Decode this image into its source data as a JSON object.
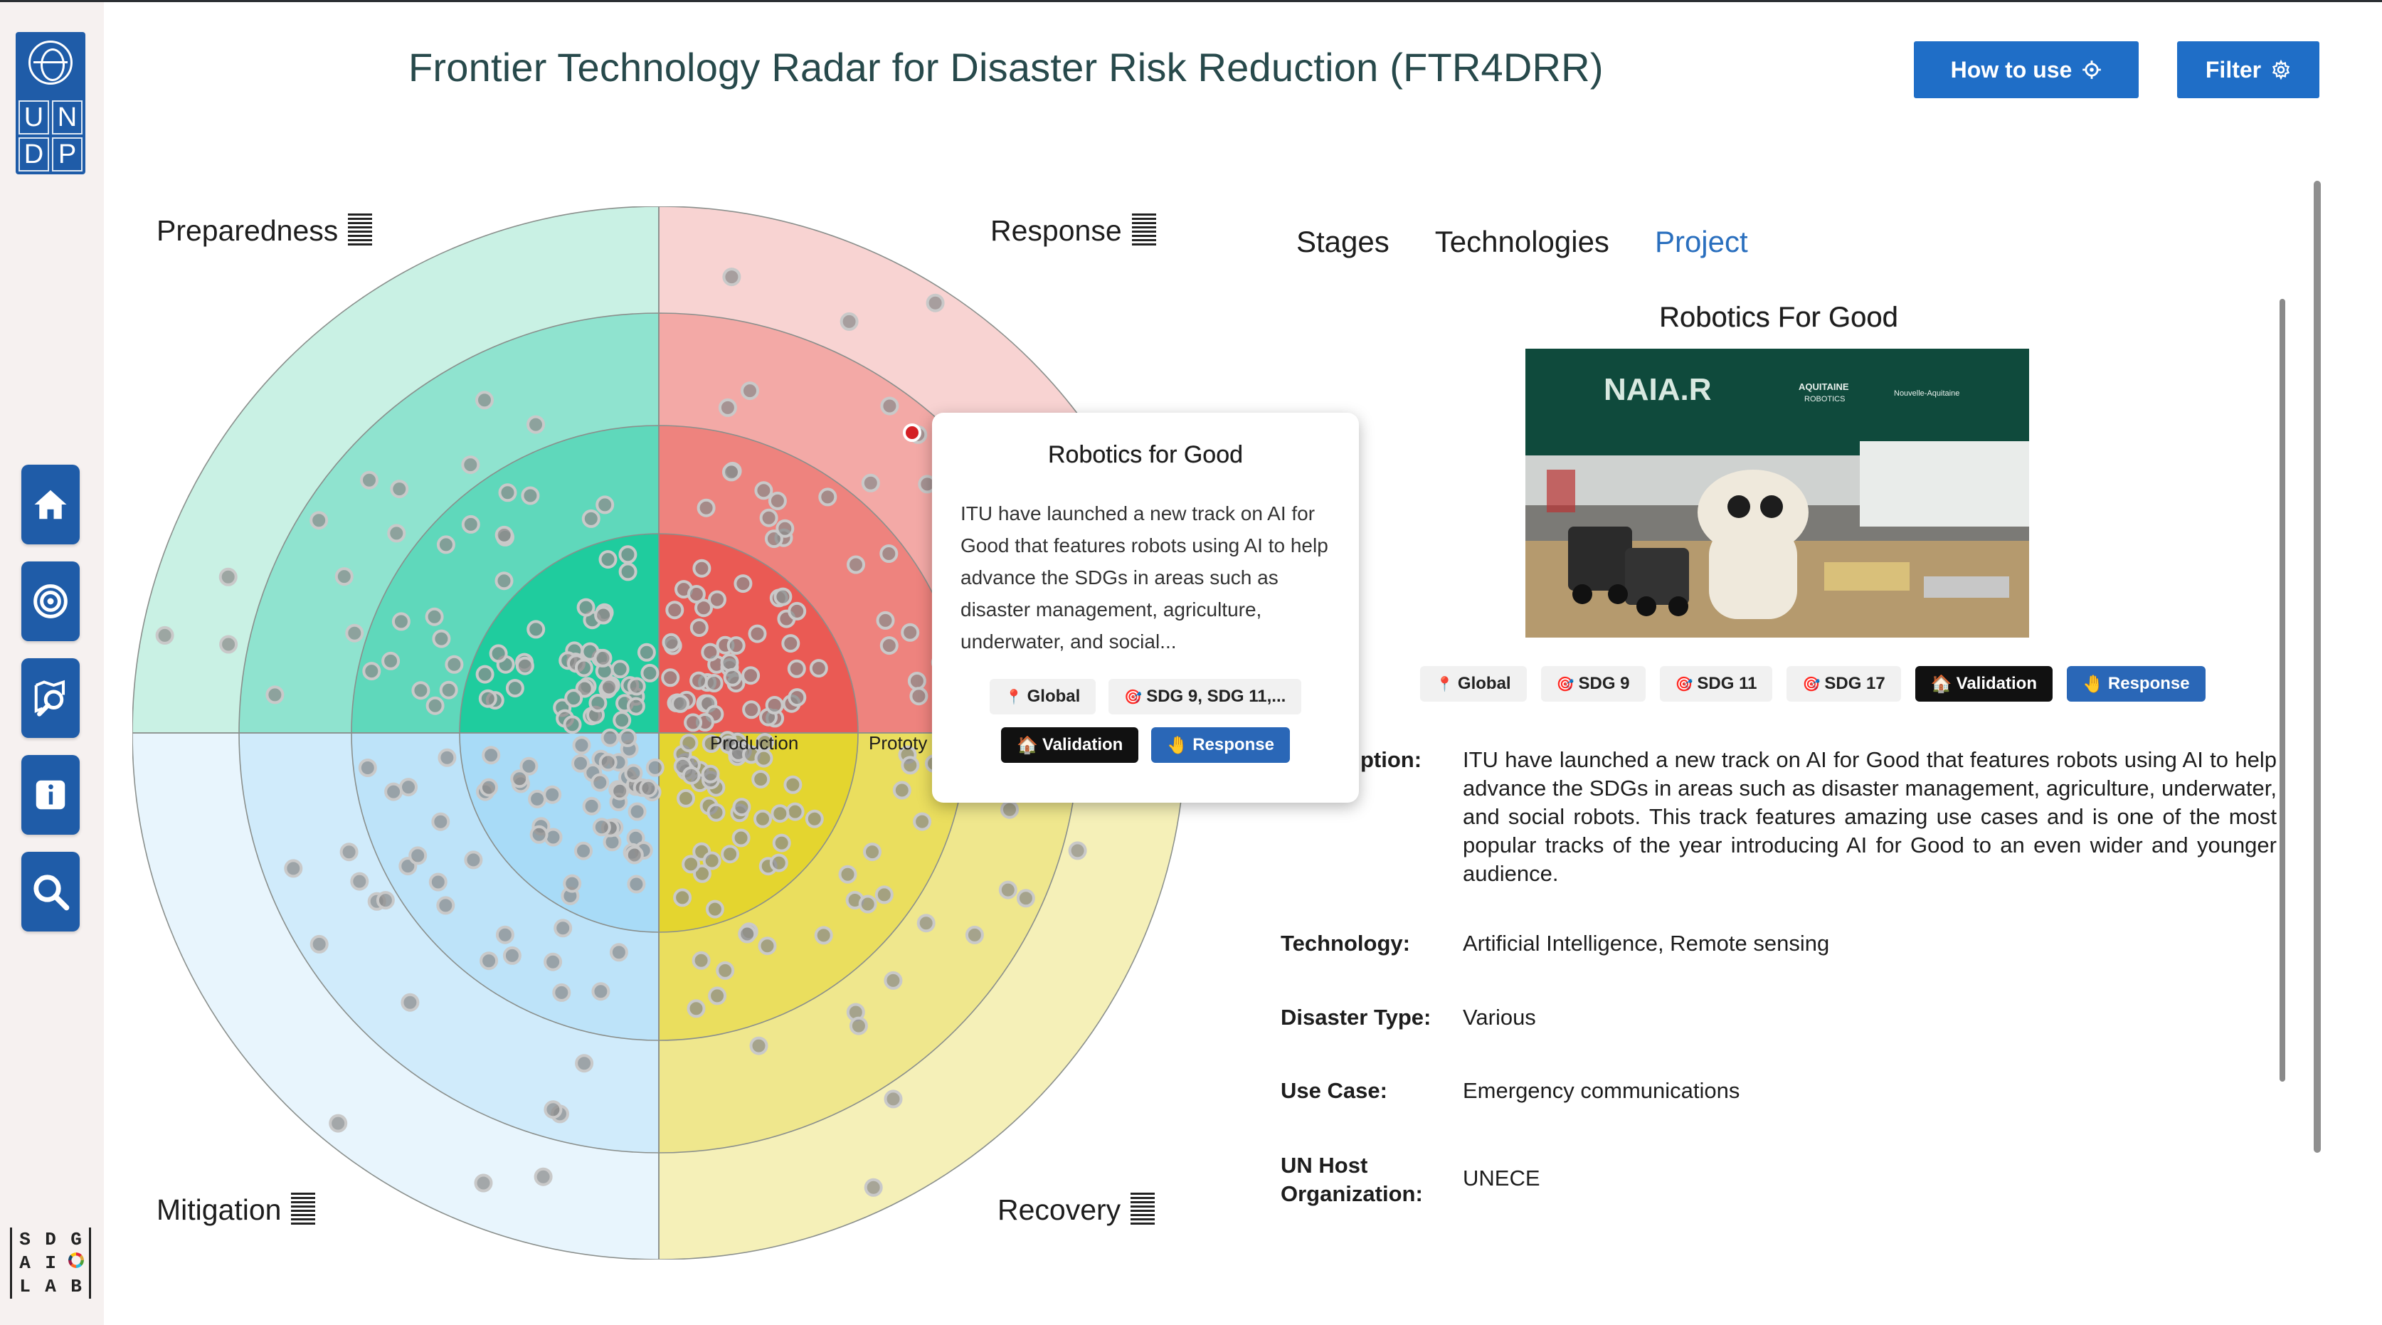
{
  "header": {
    "title": "Frontier Technology Radar for Disaster Risk Reduction (FTR4DRR)",
    "how_to_use_label": "How to use",
    "filter_label": "Filter"
  },
  "logo": {
    "undp_letters": [
      "U",
      "N",
      "D",
      "P"
    ],
    "sdg_letters": [
      "S",
      "D",
      "G",
      "A",
      "I",
      "L",
      "A",
      "B"
    ]
  },
  "sidebar": {
    "items": [
      {
        "name": "home",
        "icon": "home-icon"
      },
      {
        "name": "radar",
        "icon": "target-icon"
      },
      {
        "name": "explore",
        "icon": "map-search-icon"
      },
      {
        "name": "info",
        "icon": "info-icon"
      },
      {
        "name": "search",
        "icon": "search-icon"
      }
    ]
  },
  "radar": {
    "quadrants": [
      "Preparedness",
      "Response",
      "Mitigation",
      "Recovery"
    ],
    "ring_labels": [
      "Production",
      "Prototy"
    ],
    "colors": {
      "preparedness": [
        "#c9f1e4",
        "#8fe3cf",
        "#5fd8bb",
        "#1fcc9e"
      ],
      "response": [
        "#f8d3d2",
        "#f3a9a6",
        "#ee837e",
        "#ea5a54"
      ],
      "mitigation": [
        "#e8f5fd",
        "#d0ebfb",
        "#bde3f9",
        "#a8dbf7"
      ],
      "recovery": [
        "#f5f0b8",
        "#efe78d",
        "#eade5e",
        "#e4d52f"
      ]
    }
  },
  "tooltip": {
    "title": "Robotics for Good",
    "text": "ITU have launched a new track on AI for Good that features robots using AI to help advance the SDGs in areas such as disaster management, agriculture, underwater, and social...",
    "tags": [
      {
        "label": "Global",
        "style": "light",
        "icon": "pin-icon"
      },
      {
        "label": "SDG 9, SDG 11,...",
        "style": "light",
        "icon": "dart-icon"
      },
      {
        "label": "Validation",
        "style": "dark",
        "icon": "house-icon"
      },
      {
        "label": "Response",
        "style": "blue",
        "icon": "hand-icon"
      }
    ]
  },
  "panel": {
    "tabs": [
      "Stages",
      "Technologies",
      "Project"
    ],
    "active_tab": "Project",
    "project_title": "Robotics For Good",
    "image_texts": {
      "banner": "NAIA.R",
      "sponsor1": "AQUITAINE",
      "sponsor1b": "ROBOTICS",
      "sponsor2": "Nouvelle-Aquitaine"
    },
    "tags": [
      {
        "label": "Global",
        "style": "light",
        "icon": "pin-icon"
      },
      {
        "label": "SDG 9",
        "style": "light",
        "icon": "dart-icon"
      },
      {
        "label": "SDG 11",
        "style": "light",
        "icon": "dart-icon"
      },
      {
        "label": "SDG 17",
        "style": "light",
        "icon": "dart-icon"
      },
      {
        "label": "Validation",
        "style": "dark",
        "icon": "house-icon"
      },
      {
        "label": "Response",
        "style": "blue",
        "icon": "hand-icon"
      }
    ],
    "details": {
      "description_label": "ption:",
      "description": "ITU have launched a new track on AI for Good that features robots using AI to help advance the SDGs in areas such as disaster management, agriculture, underwater, and social robots. This track features amazing use cases and is one of the most popular tracks of the year introducing AI for Good to an even wider and younger audience.",
      "technology_label": "Technology:",
      "technology": "Artificial Intelligence, Remote sensing",
      "disaster_label": "Disaster Type:",
      "disaster": "Various",
      "use_case_label": "Use Case:",
      "use_case": "Emergency communications",
      "host_label": "UN Host Organization:",
      "host": "UNECE"
    }
  }
}
